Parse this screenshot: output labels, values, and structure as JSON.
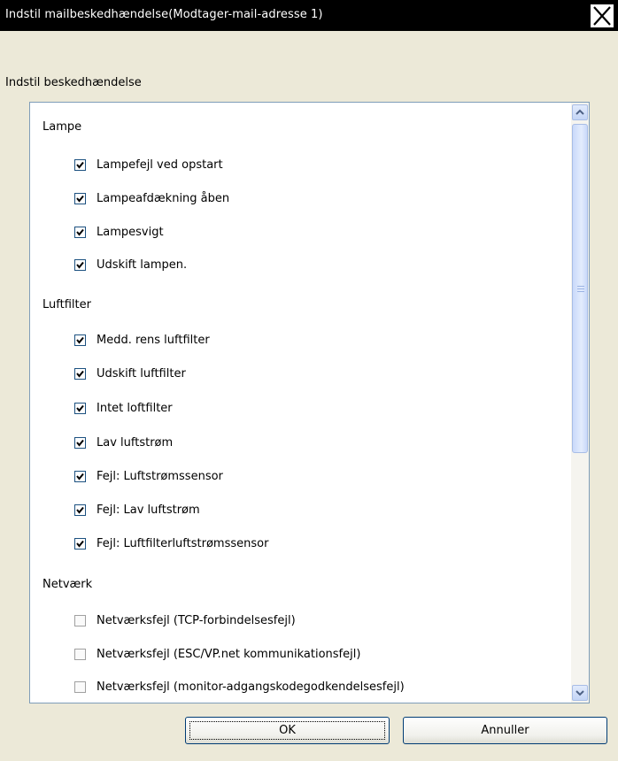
{
  "window": {
    "title": "Indstil mailbeskedhændelse(Modtager-mail-adresse 1)",
    "close_label": "close"
  },
  "caption": "Indstil beskedhændelse",
  "groups": [
    {
      "label": "Lampe",
      "items": [
        {
          "label": "Lampefejl ved opstart",
          "checked": true
        },
        {
          "label": "Lampeafdækning åben",
          "checked": true
        },
        {
          "label": "Lampesvigt",
          "checked": true
        },
        {
          "label": "Udskift lampen.",
          "checked": true
        }
      ]
    },
    {
      "label": "Luftfilter",
      "items": [
        {
          "label": "Medd. rens luftfilter",
          "checked": true
        },
        {
          "label": "Udskift luftfilter",
          "checked": true
        },
        {
          "label": "Intet loftfilter",
          "checked": true
        },
        {
          "label": "Lav luftstrøm",
          "checked": true
        },
        {
          "label": "Fejl: Luftstrømssensor",
          "checked": true
        },
        {
          "label": "Fejl: Lav luftstrøm",
          "checked": true
        },
        {
          "label": "Fejl: Luftfilterluftstrømssensor",
          "checked": true
        }
      ]
    },
    {
      "label": "Netværk",
      "items": [
        {
          "label": "Netværksfejl (TCP-forbindelsesfejl)",
          "checked": false
        },
        {
          "label": "Netværksfejl (ESC/VP.net kommunikationsfejl)",
          "checked": false
        },
        {
          "label": "Netværksfejl (monitor-adgangskodegodkendelsesfejl)",
          "checked": false
        }
      ]
    }
  ],
  "buttons": {
    "ok": "OK",
    "cancel": "Annuller"
  },
  "colors": {
    "titlebar": "#000000",
    "dialog_bg": "#ece9d8",
    "check": "#21a121",
    "border": "#7f9db9"
  }
}
